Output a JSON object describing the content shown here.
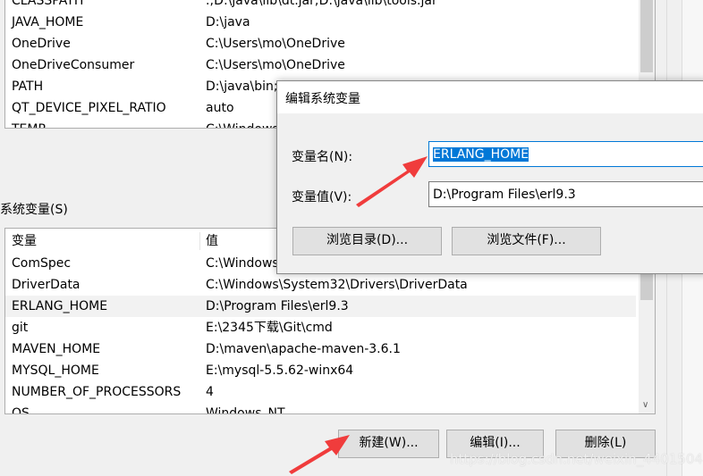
{
  "user_vars": {
    "rows": [
      {
        "name": "CLASSPATH",
        "value": ".;D:\\java\\lib\\dt.jar;D:\\java\\lib\\tools.jar"
      },
      {
        "name": "JAVA_HOME",
        "value": "D:\\java"
      },
      {
        "name": "OneDrive",
        "value": "C:\\Users\\mo\\OneDrive"
      },
      {
        "name": "OneDriveConsumer",
        "value": "C:\\Users\\mo\\OneDrive"
      },
      {
        "name": "PATH",
        "value": "D:\\java\\bin;D:\\VSCODE\\Microsoft VS Code\\bin;C:\\Users\\mo\\A"
      },
      {
        "name": "QT_DEVICE_PIXEL_RATIO",
        "value": "auto"
      },
      {
        "name": "TEMP",
        "value": "C:\\Windows"
      }
    ]
  },
  "system_vars": {
    "label": "系统变量(S)",
    "col_name": "变量",
    "col_value": "值",
    "rows": [
      {
        "name": "ComSpec",
        "value": "C:\\Windows\\system32\\cmd.exe"
      },
      {
        "name": "DriverData",
        "value": "C:\\Windows\\System32\\Drivers\\DriverData"
      },
      {
        "name": "ERLANG_HOME",
        "value": "D:\\Program Files\\erl9.3"
      },
      {
        "name": "git",
        "value": "E:\\2345下载\\Git\\cmd"
      },
      {
        "name": "MAVEN_HOME",
        "value": "D:\\maven\\apache-maven-3.6.1"
      },
      {
        "name": "MYSQL_HOME",
        "value": "E:\\mysql-5.5.62-winx64"
      },
      {
        "name": "NUMBER_OF_PROCESSORS",
        "value": "4"
      },
      {
        "name": "OS",
        "value": "Windows_NT"
      }
    ],
    "new_label": "新建(W)...",
    "edit_label": "编辑(I)...",
    "delete_label": "删除(L)"
  },
  "dialog": {
    "title": "编辑系统变量",
    "name_label": "变量名(N):",
    "name_value": "ERLANG_HOME",
    "value_label": "变量值(V):",
    "value_value": "D:\\Program Files\\erl9.3",
    "browse_dir": "浏览目录(D)...",
    "browse_file": "浏览文件(F)..."
  },
  "watermark": "https://blog.csdn.net/weixin_44015043",
  "colors": {
    "selection": "#0078d7",
    "arrow": "#f03c3c"
  }
}
